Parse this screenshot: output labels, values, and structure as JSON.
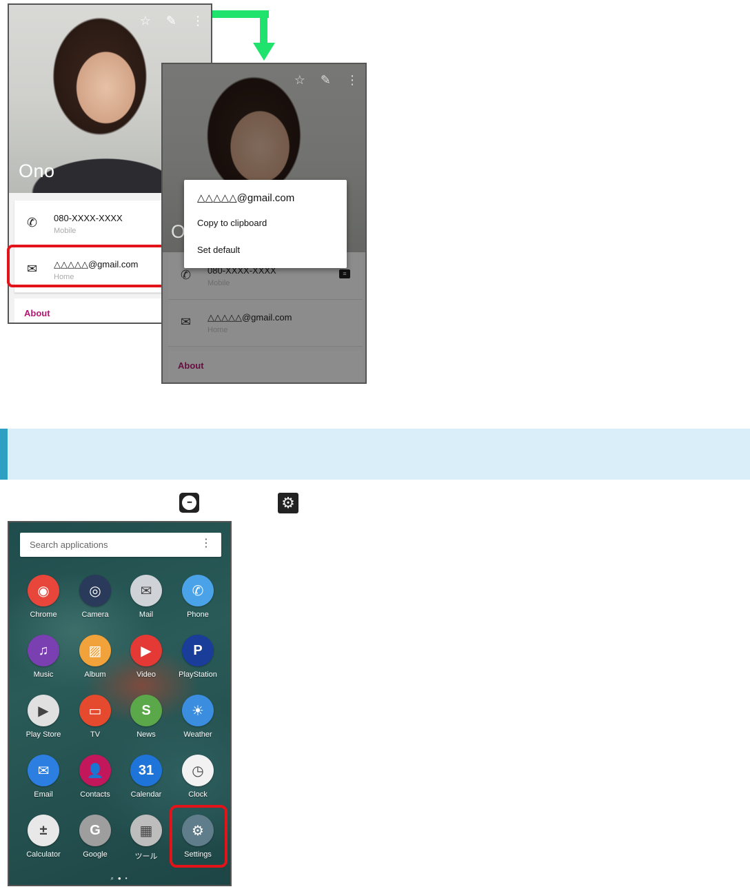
{
  "contact": {
    "name": "Ono",
    "phone": "080-XXXX-XXXX",
    "phone_type": "Mobile",
    "email": "△△△△△@gmail.com",
    "email_type": "Home",
    "about_label": "About"
  },
  "context_menu": {
    "title": "△△△△△@gmail.com",
    "items": [
      "Copy to clipboard",
      "Set default"
    ]
  },
  "icons": {
    "star": "☆",
    "edit": "✎",
    "more": "⋮",
    "phone": "✆",
    "email": "✉",
    "gear": "⚙",
    "apps": "•••"
  },
  "drawer": {
    "search_placeholder": "Search applications",
    "apps": [
      {
        "label": "Chrome",
        "glyph": "◉",
        "color": "#e8463a"
      },
      {
        "label": "Camera",
        "glyph": "◎",
        "color": "#2a3a5a"
      },
      {
        "label": "Mail",
        "glyph": "✉",
        "color": "#cfd3d8"
      },
      {
        "label": "Phone",
        "glyph": "✆",
        "color": "#4aa3e8"
      },
      {
        "label": "Music",
        "glyph": "♫",
        "color": "#7a3fb0"
      },
      {
        "label": "Album",
        "glyph": "▨",
        "color": "#f2a23a"
      },
      {
        "label": "Video",
        "glyph": "▶",
        "color": "#e53935"
      },
      {
        "label": "PlayStation",
        "glyph": "P",
        "color": "#1a3d9a"
      },
      {
        "label": "Play Store",
        "glyph": "▶",
        "color": "#e0e0e0"
      },
      {
        "label": "TV",
        "glyph": "▭",
        "color": "#e64a2e"
      },
      {
        "label": "News",
        "glyph": "S",
        "color": "#5aa84a"
      },
      {
        "label": "Weather",
        "glyph": "☀",
        "color": "#3b8de0"
      },
      {
        "label": "Email",
        "glyph": "✉",
        "color": "#2c7fe0"
      },
      {
        "label": "Contacts",
        "glyph": "👤",
        "color": "#c2185b"
      },
      {
        "label": "Calendar",
        "glyph": "31",
        "color": "#1e74d8"
      },
      {
        "label": "Clock",
        "glyph": "◷",
        "color": "#f2f2f2"
      },
      {
        "label": "Calculator",
        "glyph": "±",
        "color": "#e8e8e8"
      },
      {
        "label": "Google",
        "glyph": "G",
        "color": "#9e9e9e"
      },
      {
        "label": "ツール",
        "glyph": "▦",
        "color": "#bdbdbd"
      },
      {
        "label": "Settings",
        "glyph": "⚙",
        "color": "#607d8b"
      }
    ],
    "page_indicator": "⌕●•"
  },
  "colors": {
    "accent_green": "#1fe36d",
    "highlight_red": "#e3131a",
    "about_magenta": "#b0176f",
    "band": "#daeef9"
  }
}
